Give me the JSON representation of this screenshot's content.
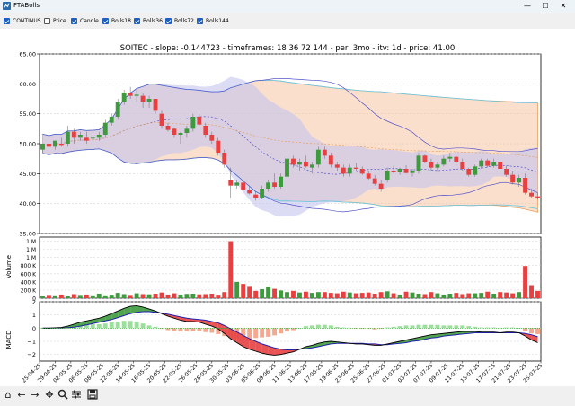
{
  "window": {
    "title": "FTABolls",
    "controls": [
      "—",
      "☐",
      "✕"
    ]
  },
  "checkboxes": [
    {
      "label": "CONTINUS",
      "checked": true
    },
    {
      "label": "Price",
      "checked": false
    },
    {
      "label": "Candle",
      "checked": true
    },
    {
      "label": "Bolls18",
      "checked": true
    },
    {
      "label": "Bolls36",
      "checked": true
    },
    {
      "label": "Bolls72",
      "checked": true
    },
    {
      "label": "Bolls144",
      "checked": true
    }
  ],
  "toolbar_icons": [
    "home-icon",
    "back-icon",
    "forward-icon",
    "pan-icon",
    "zoom-icon",
    "configure-icon",
    "save-icon"
  ],
  "chart_data": [
    {
      "type": "candlestick",
      "title": "SOITEC - slope: -0.144723 - timeframes: 18 36 72 144 - per: 3mo - itv: 1d - price: 41.00",
      "ylim": [
        35,
        65
      ],
      "yticks": [
        "35.00",
        "40.00",
        "45.00",
        "50.00",
        "55.00",
        "60.00",
        "65.00"
      ],
      "grid": true,
      "candles": [
        [
          49,
          50,
          48.5,
          50
        ],
        [
          50,
          50,
          49,
          49.5
        ],
        [
          49.5,
          50.5,
          49,
          50.5
        ],
        [
          50,
          51,
          49.5,
          49.8
        ],
        [
          50,
          53,
          49.5,
          52
        ],
        [
          52,
          52.5,
          50,
          51
        ],
        [
          51,
          52,
          50.5,
          51.5
        ],
        [
          51,
          52,
          50,
          50.5
        ],
        [
          51,
          51.5,
          50,
          51
        ],
        [
          51,
          52,
          50.5,
          51.5
        ],
        [
          51.5,
          54,
          51,
          53.5
        ],
        [
          53.5,
          55,
          53,
          54.5
        ],
        [
          54.5,
          57.5,
          54,
          57
        ],
        [
          57,
          59,
          56.5,
          58.5
        ],
        [
          58.5,
          59.5,
          57.5,
          58
        ],
        [
          58,
          59,
          57,
          58.2
        ],
        [
          58,
          58.5,
          56,
          57
        ],
        [
          57,
          58,
          56,
          57.5
        ],
        [
          57.5,
          57.5,
          55,
          55.5
        ],
        [
          55,
          55.5,
          52.5,
          53
        ],
        [
          53,
          53.5,
          52,
          52.3
        ],
        [
          52.5,
          52.7,
          51,
          51.5
        ],
        [
          51.5,
          52,
          50,
          51.8
        ],
        [
          51.8,
          53,
          51,
          52.5
        ],
        [
          52.5,
          55,
          52,
          54.5
        ],
        [
          54.5,
          55,
          53,
          53.2
        ],
        [
          53,
          53.5,
          51,
          51.5
        ],
        [
          51.5,
          52,
          50,
          50.5
        ],
        [
          50.5,
          51,
          48,
          48.5
        ],
        [
          48.5,
          49,
          46,
          46.5
        ],
        [
          44,
          46,
          41,
          43
        ],
        [
          43,
          44,
          42.5,
          43.5
        ],
        [
          43.5,
          44.5,
          42,
          42.3
        ],
        [
          42.3,
          43,
          41.5,
          41.7
        ],
        [
          41.5,
          42,
          40.5,
          41
        ],
        [
          41,
          43,
          40.8,
          42.5
        ],
        [
          42.5,
          44,
          42,
          43.5
        ],
        [
          43.5,
          45,
          42.5,
          42.8
        ],
        [
          42.8,
          45,
          42.5,
          44.5
        ],
        [
          44.5,
          48,
          44,
          47.5
        ],
        [
          47.5,
          48,
          46,
          46.5
        ],
        [
          46.5,
          47.5,
          45.5,
          47
        ],
        [
          47,
          48,
          46,
          46.2
        ],
        [
          46,
          47,
          45,
          46.5
        ],
        [
          46.5,
          49.5,
          46,
          49
        ],
        [
          49,
          49.5,
          47.5,
          48
        ],
        [
          48,
          48.5,
          46,
          46.5
        ],
        [
          46.5,
          47,
          45.5,
          46
        ],
        [
          46,
          46.5,
          44.5,
          45
        ],
        [
          45,
          46.5,
          44.5,
          46
        ],
        [
          46,
          46.8,
          45.5,
          45.8
        ],
        [
          45.8,
          46.2,
          44.8,
          45
        ],
        [
          45,
          45.5,
          44,
          44.2
        ],
        [
          44.2,
          44.8,
          43,
          43.3
        ],
        [
          43.3,
          44,
          42,
          42.5
        ],
        [
          44,
          46,
          43.5,
          45.5
        ],
        [
          45.5,
          46.3,
          45,
          45.3
        ],
        [
          45.3,
          46,
          44.8,
          45.8
        ],
        [
          45.8,
          46.4,
          45,
          45.1
        ],
        [
          45.1,
          45.8,
          44.5,
          45.5
        ],
        [
          45.5,
          48.5,
          45,
          48
        ],
        [
          48,
          48.3,
          46.8,
          47
        ],
        [
          47,
          47.5,
          45.5,
          46
        ],
        [
          46,
          47,
          45.5,
          46.5
        ],
        [
          46.5,
          48,
          46.2,
          47.5
        ],
        [
          47.5,
          48.5,
          47,
          47.8
        ],
        [
          47.8,
          48,
          46.8,
          47
        ],
        [
          47,
          47.5,
          45.5,
          45.8
        ],
        [
          45.8,
          46,
          44.5,
          44.8
        ],
        [
          44.8,
          46.5,
          44.5,
          46.2
        ],
        [
          46.2,
          47.5,
          45.8,
          47.2
        ],
        [
          47.2,
          47.5,
          46,
          46.3
        ],
        [
          46.3,
          47.5,
          46,
          47
        ],
        [
          47,
          47.6,
          45.5,
          45.8
        ],
        [
          45.8,
          46.3,
          44.5,
          44.8
        ],
        [
          44.8,
          45.5,
          43.2,
          43.5
        ],
        [
          43.5,
          44.8,
          42.8,
          44.3
        ],
        [
          44.3,
          45,
          41.5,
          41.8
        ],
        [
          41.8,
          42.5,
          41,
          41.2
        ],
        [
          41.2,
          41.8,
          40.8,
          41
        ]
      ],
      "boll_fills": [
        {
          "name": "Bolls72",
          "color": "#f5c5a3"
        },
        {
          "name": "Bolls18",
          "color": "#c5c5ef"
        }
      ],
      "boll_lines": [
        {
          "name": "Bolls72",
          "color": "#e8a060"
        },
        {
          "name": "Bolls144",
          "color": "#66c8e8"
        },
        {
          "name": "Bolls36",
          "color": "#5555cc"
        }
      ]
    },
    {
      "type": "bar",
      "ylabel": "Volume",
      "yticks": [
        "0",
        "200 K",
        "400 K",
        "600 K",
        "800 K",
        "1 M",
        "1 M",
        "1 M"
      ],
      "ylim": [
        0,
        1500000
      ],
      "values": [
        60000,
        80000,
        70000,
        90000,
        60000,
        100000,
        80000,
        90000,
        70000,
        110000,
        70000,
        85000,
        130000,
        100000,
        80000,
        120000,
        100000,
        95000,
        110000,
        140000,
        90000,
        120000,
        90000,
        105000,
        110000,
        95000,
        100000,
        110000,
        85000,
        150000,
        1400000,
        400000,
        350000,
        300000,
        180000,
        220000,
        280000,
        230000,
        190000,
        150000,
        180000,
        140000,
        160000,
        130000,
        150000,
        150000,
        130000,
        120000,
        160000,
        140000,
        120000,
        130000,
        140000,
        110000,
        150000,
        170000,
        120000,
        90000,
        160000,
        140000,
        110000,
        100000,
        150000,
        120000,
        90000,
        110000,
        130000,
        100000,
        120000,
        120000,
        130000,
        160000,
        110000,
        150000,
        140000,
        120000,
        150000,
        790000,
        320000,
        180000
      ],
      "up_color": "#3d9a3d",
      "down_color": "#e84040"
    },
    {
      "type": "line",
      "ylabel": "MACD",
      "yticks": [
        "2",
        "1",
        "0",
        "−1",
        "−2"
      ],
      "ylim": [
        -2.5,
        2
      ],
      "x_tick_labels": [
        "25-04-25",
        "29-04-25",
        "02-05-25",
        "06-05-25",
        "08-05-25",
        "12-05-25",
        "14-05-25",
        "16-05-25",
        "20-05-25",
        "22-05-25",
        "26-05-25",
        "28-05-25",
        "30-05-25",
        "03-06-25",
        "05-06-25",
        "09-06-25",
        "11-06-25",
        "13-06-25",
        "17-06-25",
        "19-06-25",
        "23-06-25",
        "25-06-25",
        "27-06-25",
        "01-07-25",
        "03-07-25",
        "07-07-25",
        "09-07-25",
        "11-07-25",
        "15-07-25",
        "17-07-25",
        "21-07-25",
        "23-07-25",
        "25-07-25"
      ],
      "series": [
        {
          "name": "",
          "values": [
            0,
            0,
            0.02,
            0.05,
            0.15,
            0.3,
            0.45,
            0.55,
            0.65,
            0.75,
            0.9,
            1.1,
            1.3,
            1.5,
            1.65,
            1.7,
            1.6,
            1.45,
            1.3,
            1.1,
            0.9,
            0.75,
            0.6,
            0.5,
            0.5,
            0.45,
            0.3,
            0.15,
            -0.05,
            -0.4,
            -0.8,
            -1.1,
            -1.4,
            -1.6,
            -1.75,
            -1.9,
            -2.0,
            -2.05,
            -2.0,
            -1.9,
            -1.8,
            -1.6,
            -1.4,
            -1.3,
            -1.15,
            -1.05,
            -1.0,
            -1.05,
            -1.1,
            -1.15,
            -1.2,
            -1.2,
            -1.25,
            -1.3,
            -1.3,
            -1.2,
            -1.1,
            -1.0,
            -0.9,
            -0.8,
            -0.7,
            -0.6,
            -0.5,
            -0.45,
            -0.4,
            -0.35,
            -0.3,
            -0.25,
            -0.25,
            -0.25,
            -0.3,
            -0.3,
            -0.3,
            -0.35,
            -0.3,
            -0.3,
            -0.35,
            -0.6,
            -0.9,
            -1.1
          ]
        },
        {
          "name": "",
          "values": [
            0,
            0,
            0,
            0.01,
            0.03,
            0.08,
            0.15,
            0.25,
            0.35,
            0.45,
            0.55,
            0.65,
            0.8,
            0.95,
            1.1,
            1.2,
            1.25,
            1.25,
            1.2,
            1.15,
            1.05,
            0.95,
            0.85,
            0.75,
            0.7,
            0.65,
            0.6,
            0.5,
            0.4,
            0.2,
            -0.05,
            -0.3,
            -0.55,
            -0.8,
            -1.0,
            -1.2,
            -1.35,
            -1.5,
            -1.6,
            -1.65,
            -1.65,
            -1.6,
            -1.55,
            -1.5,
            -1.4,
            -1.3,
            -1.2,
            -1.15,
            -1.15,
            -1.15,
            -1.15,
            -1.15,
            -1.2,
            -1.2,
            -1.25,
            -1.25,
            -1.2,
            -1.15,
            -1.1,
            -1.0,
            -0.95,
            -0.85,
            -0.75,
            -0.7,
            -0.6,
            -0.55,
            -0.5,
            -0.45,
            -0.4,
            -0.35,
            -0.35,
            -0.35,
            -0.35,
            -0.35,
            -0.35,
            -0.35,
            -0.35,
            -0.4,
            -0.5,
            -0.65
          ]
        }
      ],
      "histogram": [
        0,
        0,
        0.02,
        0.04,
        0.12,
        0.22,
        0.3,
        0.3,
        0.3,
        0.3,
        0.35,
        0.45,
        0.5,
        0.55,
        0.55,
        0.5,
        0.35,
        0.2,
        0.1,
        -0.05,
        -0.15,
        -0.2,
        -0.25,
        -0.25,
        -0.2,
        -0.2,
        -0.3,
        -0.35,
        -0.45,
        -0.6,
        -0.75,
        -0.8,
        -0.85,
        -0.8,
        -0.75,
        -0.7,
        -0.65,
        -0.55,
        -0.4,
        -0.25,
        -0.15,
        0,
        0.15,
        0.2,
        0.25,
        0.25,
        0.2,
        0.1,
        0.05,
        0,
        -0.05,
        -0.05,
        -0.05,
        -0.1,
        -0.05,
        0.05,
        0.1,
        0.15,
        0.2,
        0.2,
        0.25,
        0.25,
        0.25,
        0.25,
        0.2,
        0.2,
        0.2,
        0.2,
        0.15,
        0.1,
        0.05,
        0.05,
        0.05,
        0,
        0.05,
        0.05,
        0,
        -0.2,
        -0.4,
        -0.45
      ],
      "macd_color": "#000000",
      "signal_color": "#2222aa",
      "fill_up": "#3d9a3d",
      "fill_down": "#e84040"
    }
  ]
}
